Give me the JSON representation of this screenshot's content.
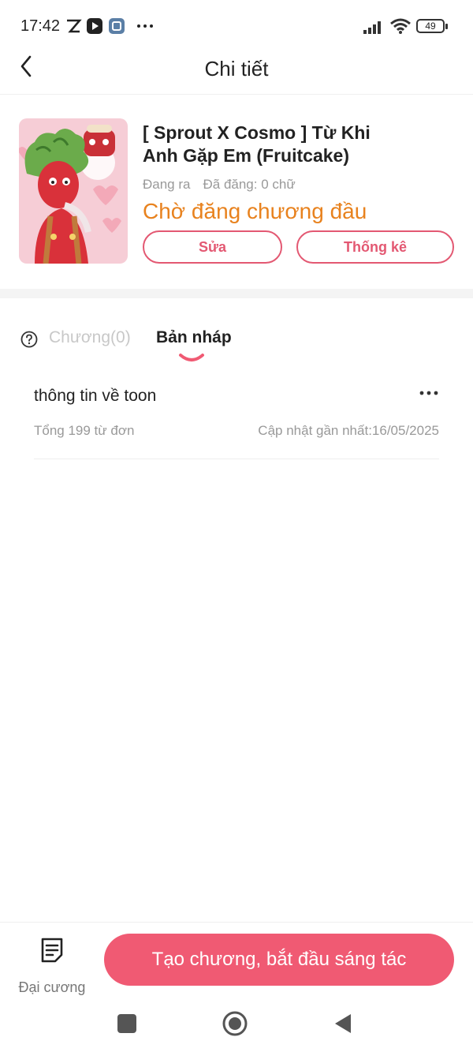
{
  "status_bar": {
    "time": "17:42",
    "battery": "49",
    "icons": [
      "notification-icon",
      "media-play-icon",
      "app-icon",
      "more-dots-icon",
      "signal-icon",
      "wifi-icon",
      "battery-icon"
    ]
  },
  "header": {
    "title": "Chi tiết",
    "back_icon": "back-arrow-icon"
  },
  "book": {
    "title": "[ Sprout X Cosmo ] Từ Khi Anh Gặp Em (Fruitcake)",
    "status": "Đang ra",
    "published_words": "Đã đăng: 0 chữ",
    "highlight_status": "Chờ đăng chương đầu",
    "edit_label": "Sửa",
    "stats_label": "Thống kê"
  },
  "tabs": {
    "chapters_label": "Chương(0)",
    "drafts_label": "Bản nháp",
    "active": "drafts"
  },
  "drafts": [
    {
      "title": "thông tin về toon",
      "word_count": "Tổng 199 từ đơn",
      "updated": "Cập nhật gần nhất:16/05/2025"
    }
  ],
  "bottom_bar": {
    "outline_label": "Đại cương",
    "create_label": "Tạo chương, bắt đầu sáng tác"
  },
  "colors": {
    "accent": "#f05a73",
    "accent_border": "#e35872",
    "status_orange": "#e8821e",
    "muted_text": "#999999"
  }
}
